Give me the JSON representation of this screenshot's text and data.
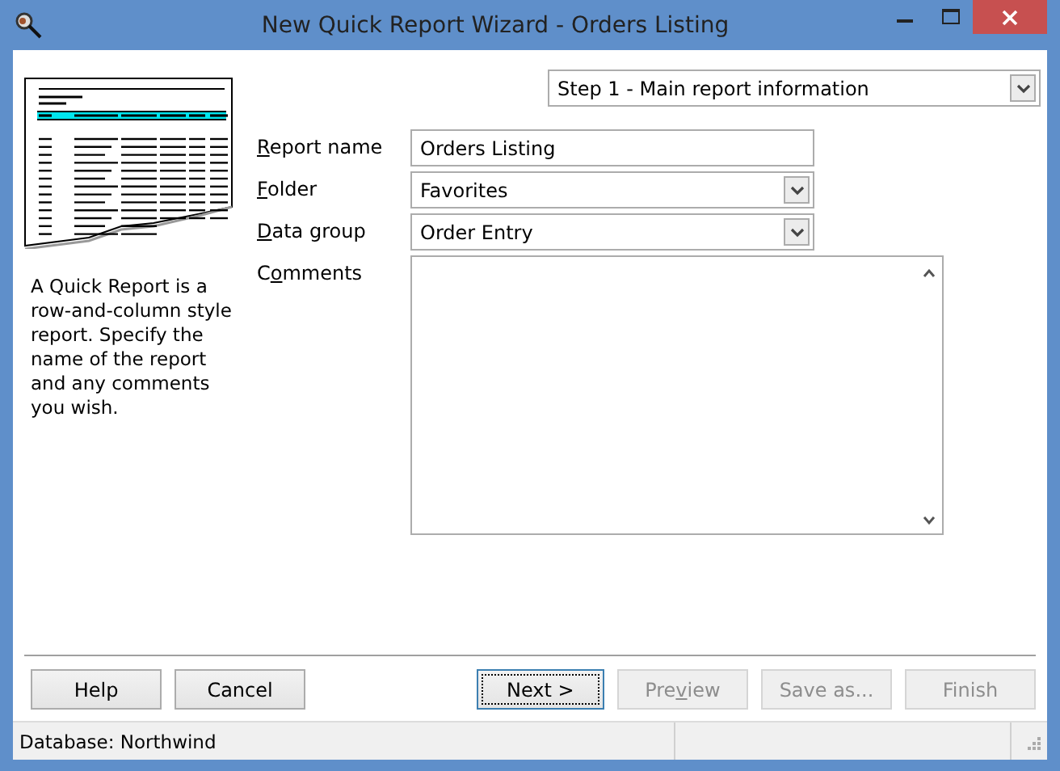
{
  "window": {
    "title": "New Quick Report Wizard - Orders Listing"
  },
  "description": "A Quick Report is a row-and-column style report. Specify the name of the report and any comments you wish.",
  "step_selector": {
    "value": "Step 1 - Main report information"
  },
  "fields": [
    {
      "kind": "text",
      "access_key": "R",
      "label_end": "eport name",
      "value": "Orders Listing"
    },
    {
      "kind": "dropdown",
      "access_key": "F",
      "label_end": "older",
      "value": "Favorites"
    },
    {
      "kind": "dropdown",
      "access_key": "D",
      "label_end": "ata group",
      "value": "Order Entry"
    },
    {
      "kind": "textarea",
      "label_start": "C",
      "access_key": "o",
      "label_end": "mments"
    }
  ],
  "buttons": [
    {
      "label": "Help",
      "disabled": false,
      "default": false
    },
    {
      "label": "Cancel",
      "disabled": false,
      "default": false
    },
    {
      "label": "Next >",
      "disabled": false,
      "default": true
    },
    {
      "label_start": "Pre",
      "access_key": "v",
      "label_end": "iew",
      "disabled": true,
      "default": false
    },
    {
      "label": "Save as...",
      "disabled": true,
      "default": false
    },
    {
      "label": "Finish",
      "disabled": true,
      "default": false
    }
  ],
  "status_bar": {
    "text": "Database: Northwind"
  }
}
